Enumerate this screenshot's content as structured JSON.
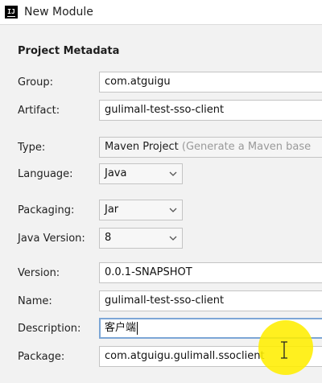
{
  "window": {
    "title": "New Module",
    "app_icon_text": "IJ"
  },
  "section_title": "Project Metadata",
  "fields": {
    "group": {
      "label": "Group:",
      "value": "com.atguigu"
    },
    "artifact": {
      "label": "Artifact:",
      "value": "gulimall-test-sso-client"
    },
    "type": {
      "label": "Type:",
      "value": "Maven Project",
      "hint": "(Generate a Maven base"
    },
    "language": {
      "label": "Language:",
      "value": "Java"
    },
    "packaging": {
      "label": "Packaging:",
      "value": "Jar"
    },
    "java_version": {
      "label": "Java Version:",
      "value": "8"
    },
    "version": {
      "label": "Version:",
      "value": "0.0.1-SNAPSHOT"
    },
    "name": {
      "label": "Name:",
      "value": "gulimall-test-sso-client"
    },
    "description": {
      "label": "Description:",
      "value": "客户端"
    },
    "package": {
      "label": "Package:",
      "value": "com.atguigu.gulimall.ssoclient"
    }
  },
  "colors": {
    "focus_border": "#7ca6d6",
    "cursor_highlight": "#ffee00"
  },
  "icons": {
    "app": "intellij-idea-icon",
    "dropdown": "chevron-down-icon",
    "cursor": "text-cursor-icon"
  }
}
